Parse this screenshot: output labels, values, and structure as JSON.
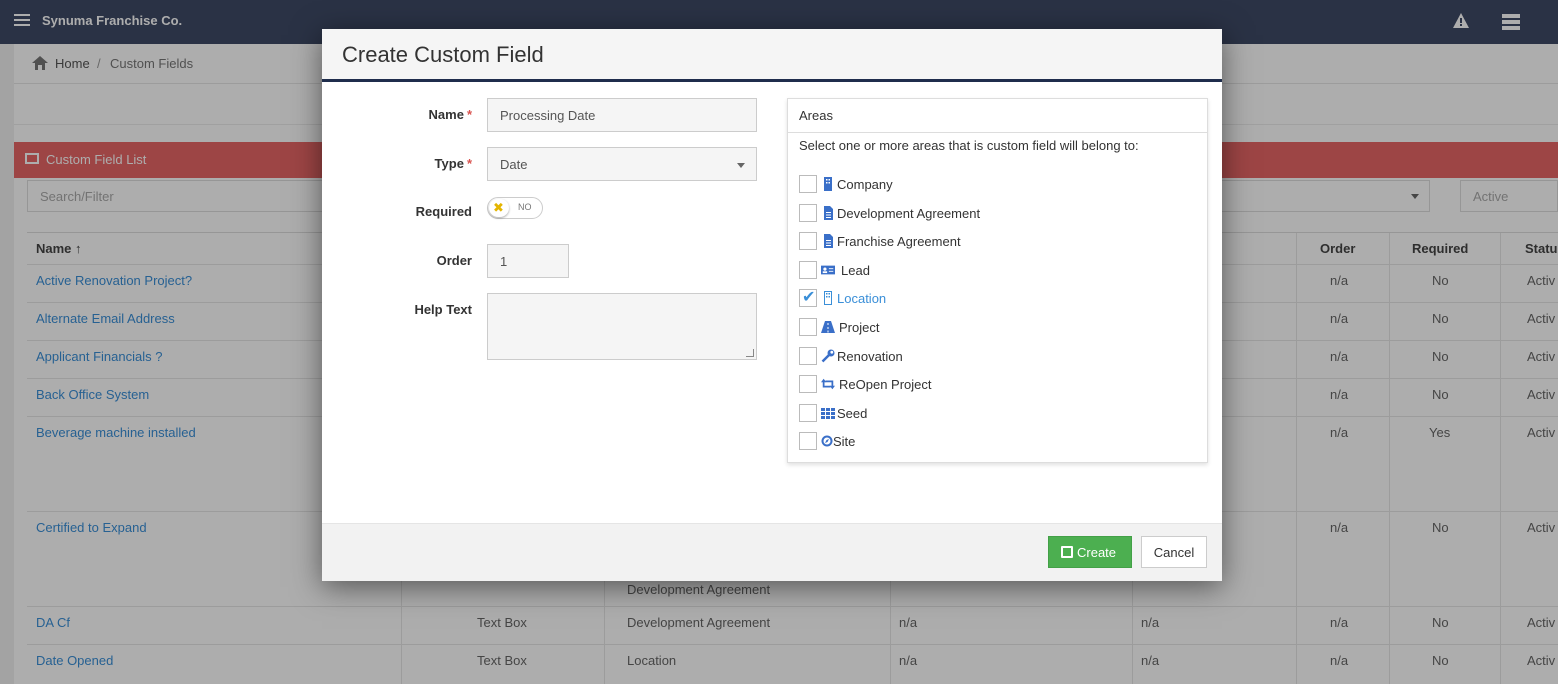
{
  "app": {
    "brand": "Synuma Franchise Co."
  },
  "breadcrumb": {
    "home": "Home",
    "separator": "/",
    "current": "Custom Fields"
  },
  "list": {
    "title": "Custom Field List",
    "search_placeholder": "Search/Filter",
    "status_filter": "Active",
    "columns": {
      "name": "Name ↑",
      "order": "Order",
      "required": "Required",
      "status": "Statu"
    },
    "rows": [
      {
        "name": "Active Renovation Project?",
        "order": "n/a",
        "required": "No",
        "status": "Activ"
      },
      {
        "name": "Alternate Email Address",
        "order": "n/a",
        "required": "No",
        "status": "Activ"
      },
      {
        "name": "Applicant Financials ?",
        "order": "n/a",
        "required": "No",
        "status": "Activ"
      },
      {
        "name": "Back Office System",
        "order": "n/a",
        "required": "No",
        "status": "Activ"
      },
      {
        "name": "Beverage machine installed",
        "order": "n/a",
        "required": "Yes",
        "status": "Activ"
      },
      {
        "name": "Certified to Expand",
        "order": "n/a",
        "required": "No",
        "status": "Activ",
        "area": "Development Agreement"
      },
      {
        "name": "DA Cf",
        "type": "Text Box",
        "area": "Development Agreement",
        "c4": "n/a",
        "c5": "n/a",
        "order": "n/a",
        "required": "No",
        "status": "Activ"
      },
      {
        "name": "Date Opened",
        "type": "Text Box",
        "area": "Location",
        "c4": "n/a",
        "c5": "n/a",
        "order": "n/a",
        "required": "No",
        "status": "Activ"
      }
    ]
  },
  "modal": {
    "title": "Create Custom Field",
    "name_label": "Name",
    "name_value": "Processing Date",
    "type_label": "Type",
    "type_value": "Date",
    "required_label": "Required",
    "required_toggle": "NO",
    "order_label": "Order",
    "order_value": "1",
    "help_label": "Help Text",
    "help_value": "",
    "areas_title": "Areas",
    "areas_prompt": "Select one or more areas that is custom field will belong to:",
    "areas": [
      {
        "label": "Company",
        "icon": "building-icon",
        "checked": false
      },
      {
        "label": "Development Agreement",
        "icon": "document-icon",
        "checked": false
      },
      {
        "label": "Franchise Agreement",
        "icon": "document-icon",
        "checked": false
      },
      {
        "label": "Lead",
        "icon": "id-card-icon",
        "checked": false
      },
      {
        "label": "Location",
        "icon": "building-icon",
        "checked": true
      },
      {
        "label": "Project",
        "icon": "road-icon",
        "checked": false
      },
      {
        "label": "Renovation",
        "icon": "wrench-icon",
        "checked": false
      },
      {
        "label": "ReOpen Project",
        "icon": "retweet-icon",
        "checked": false
      },
      {
        "label": "Seed",
        "icon": "grid-icon",
        "checked": false
      },
      {
        "label": "Site",
        "icon": "compass-icon",
        "checked": false
      }
    ],
    "create_label": "Create",
    "cancel_label": "Cancel"
  },
  "colors": {
    "accent": "#3a8fd8",
    "header": "#3e4a66",
    "list_header": "#e86666",
    "create": "#4caf50",
    "required_star": "#d9534f"
  }
}
